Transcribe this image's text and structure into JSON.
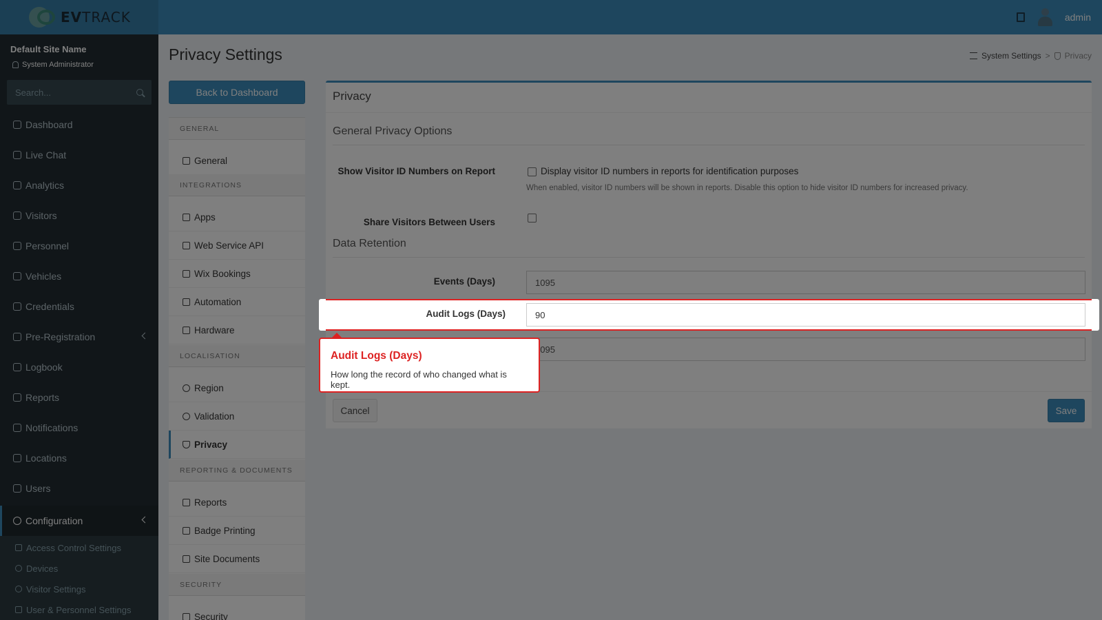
{
  "header": {
    "logo_text_bold": "EV",
    "logo_text": "TRACK",
    "username": "admin"
  },
  "sidebar": {
    "site_name": "Default Site Name",
    "role": "System Administrator",
    "search_placeholder": "Search...",
    "items": [
      {
        "label": "Dashboard",
        "icon": "dashboard-icon"
      },
      {
        "label": "Live Chat",
        "icon": "headset-icon"
      },
      {
        "label": "Analytics",
        "icon": "analytics-icon"
      },
      {
        "label": "Visitors",
        "icon": "eye-icon"
      },
      {
        "label": "Personnel",
        "icon": "personnel-icon"
      },
      {
        "label": "Vehicles",
        "icon": "car-icon"
      },
      {
        "label": "Credentials",
        "icon": "credentials-icon"
      },
      {
        "label": "Pre-Registration",
        "icon": "arrows-icon"
      },
      {
        "label": "Logbook",
        "icon": "book-icon"
      },
      {
        "label": "Reports",
        "icon": "reports-icon"
      },
      {
        "label": "Notifications",
        "icon": "notifications-icon"
      },
      {
        "label": "Locations",
        "icon": "map-icon"
      },
      {
        "label": "Users",
        "icon": "users-icon"
      },
      {
        "label": "Configuration",
        "icon": "gear-icon"
      }
    ],
    "sub_items": [
      {
        "label": "Access Control Settings",
        "icon": "lock-icon"
      },
      {
        "label": "Devices",
        "icon": "gear-icon"
      },
      {
        "label": "Visitor Settings",
        "icon": "eye-icon"
      },
      {
        "label": "User & Personnel Settings",
        "icon": "users-icon"
      }
    ]
  },
  "page": {
    "title": "Privacy Settings",
    "breadcrumb": {
      "parent": "System Settings",
      "separator": ">",
      "current": "Privacy"
    },
    "back_button": "Back to Dashboard"
  },
  "settings_menu": {
    "sections": [
      {
        "title": "GENERAL",
        "items": [
          {
            "label": "General",
            "icon": "list-icon"
          }
        ]
      },
      {
        "title": "INTEGRATIONS",
        "items": [
          {
            "label": "Apps",
            "icon": "grid-icon"
          },
          {
            "label": "Web Service API",
            "icon": "api-icon"
          },
          {
            "label": "Wix Bookings",
            "icon": "calendar-icon"
          },
          {
            "label": "Automation",
            "icon": "bolt-icon"
          },
          {
            "label": "Hardware",
            "icon": "hardware-icon"
          }
        ]
      },
      {
        "title": "LOCALISATION",
        "items": [
          {
            "label": "Region",
            "icon": "globe-icon"
          },
          {
            "label": "Validation",
            "icon": "check-circle-icon"
          },
          {
            "label": "Privacy",
            "icon": "shield-icon"
          }
        ]
      },
      {
        "title": "REPORTING & DOCUMENTS",
        "items": [
          {
            "label": "Reports",
            "icon": "bar-chart-icon"
          },
          {
            "label": "Badge Printing",
            "icon": "printer-icon"
          },
          {
            "label": "Site Documents",
            "icon": "document-icon"
          }
        ]
      },
      {
        "title": "SECURITY",
        "items": [
          {
            "label": "Security",
            "icon": "lock-icon"
          }
        ]
      }
    ]
  },
  "privacy": {
    "box_title": "Privacy",
    "general_section": "General Privacy Options",
    "show_visitor_label": "Show Visitor ID Numbers on Report",
    "show_visitor_checkbox_text": "Display visitor ID numbers in reports for identification purposes",
    "show_visitor_help": "When enabled, visitor ID numbers will be shown in reports. Disable this option to hide visitor ID numbers for increased privacy.",
    "share_label": "Share Visitors Between Users",
    "retention_section": "Data Retention",
    "events_label": "Events (Days)",
    "events_value": "1095",
    "audit_label": "Audit Logs (Days)",
    "audit_value": "90",
    "third_value": "1095",
    "cancel": "Cancel",
    "save": "Save"
  },
  "tooltip": {
    "title": "Audit Logs (Days)",
    "body": "How long the record of who changed what is kept."
  },
  "colors": {
    "primary": "#3c8dbc",
    "sidebar": "#222d32",
    "highlight": "#dd2222"
  }
}
